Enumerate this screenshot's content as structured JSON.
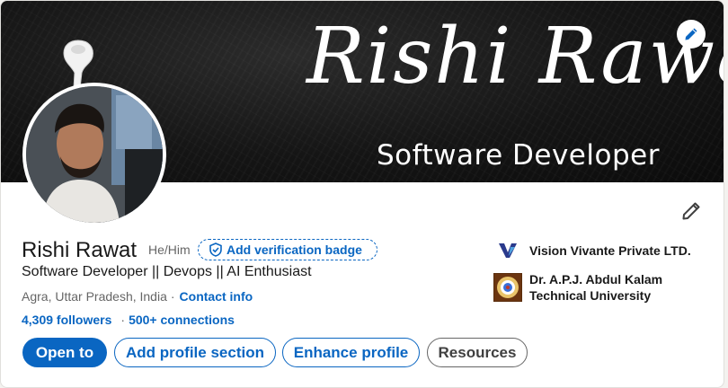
{
  "banner": {
    "script_text": "Rishi Rawat",
    "subtitle": "Software Developer",
    "edit_icon": "pencil-icon"
  },
  "profile": {
    "name": "Rishi Rawat",
    "pronouns": "He/Him",
    "verification_label": "Add verification badge",
    "headline": "Software Developer || Devops || AI Enthusiast",
    "location": "Agra, Uttar Pradesh, India",
    "location_separator": "·",
    "contact_info": "Contact info",
    "followers": "4,309 followers",
    "stats_separator": "·",
    "connections": "500+ connections"
  },
  "actions": {
    "open_to": "Open to",
    "add_section": "Add profile section",
    "enhance": "Enhance profile",
    "resources": "Resources"
  },
  "organizations": [
    {
      "name": "Vision Vivante Private LTD.",
      "logo": "vision-vivante-logo"
    },
    {
      "name_line1": "Dr. A.P.J. Abdul Kalam",
      "name_line2": "Technical University",
      "logo": "university-seal-logo"
    }
  ],
  "colors": {
    "accent": "#0a66c2",
    "text": "#191919",
    "muted": "#666666",
    "banner_bg": "#151515"
  }
}
